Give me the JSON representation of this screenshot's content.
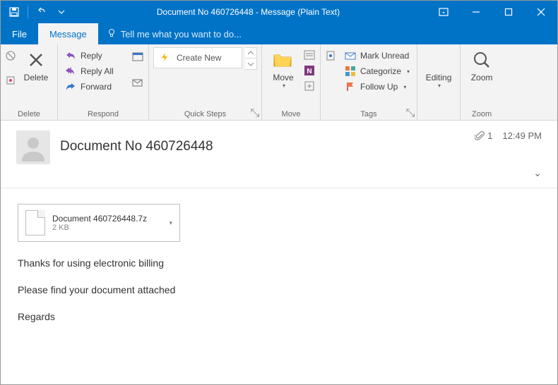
{
  "window": {
    "title": "Document No 460726448 - Message (Plain Text)"
  },
  "tabs": {
    "file": "File",
    "message": "Message",
    "tellme": "Tell me what you want to do..."
  },
  "ribbon": {
    "delete": {
      "big": "Delete",
      "group": "Delete"
    },
    "respond": {
      "reply": "Reply",
      "reply_all": "Reply All",
      "forward": "Forward",
      "group": "Respond"
    },
    "quicksteps": {
      "create_new": "Create New",
      "group": "Quick Steps"
    },
    "move": {
      "big": "Move",
      "group": "Move"
    },
    "tags": {
      "mark_unread": "Mark Unread",
      "categorize": "Categorize",
      "follow_up": "Follow Up",
      "group": "Tags"
    },
    "editing": {
      "label": "Editing"
    },
    "zoom": {
      "big": "Zoom",
      "group": "Zoom"
    }
  },
  "header": {
    "subject": "Document No 460726448",
    "attachment_count": "1",
    "time": "12:49 PM"
  },
  "attachment": {
    "filename": "Document 460726448.7z",
    "size": "2 KB"
  },
  "body": {
    "line1": "Thanks for using electronic billing",
    "line2": "Please find your document attached",
    "line3": "Regards"
  }
}
